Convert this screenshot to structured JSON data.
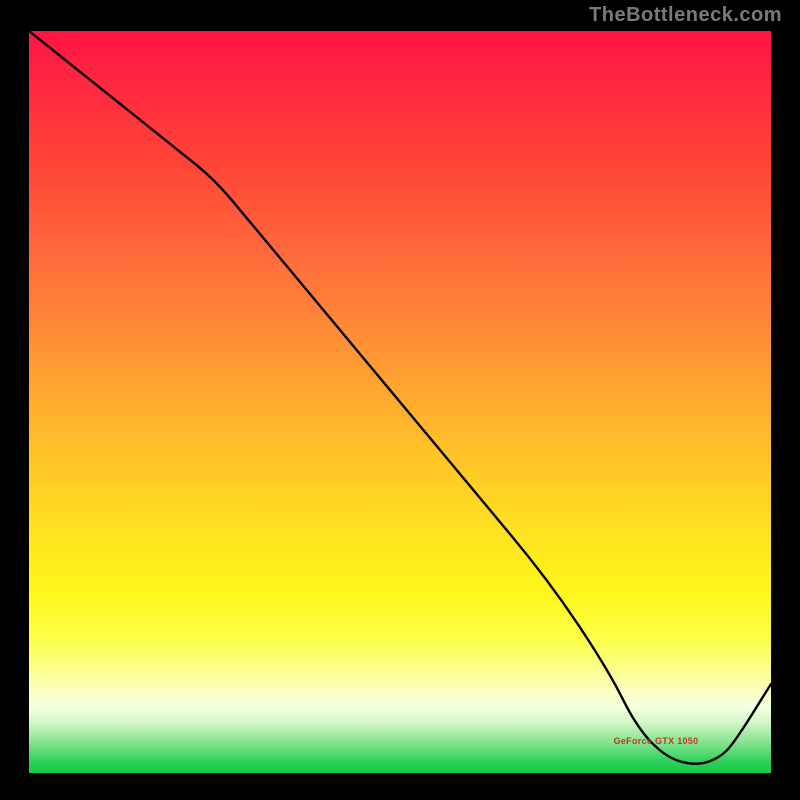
{
  "attribution": "TheBottleneck.com",
  "chart_data": {
    "type": "line",
    "title": "",
    "xlabel": "",
    "ylabel": "",
    "xlim": [
      0,
      100
    ],
    "ylim": [
      0,
      100
    ],
    "grid": false,
    "legend_position": "none",
    "series": [
      {
        "name": "GeForce GTX 1050",
        "x": [
          0,
          10,
          20,
          25,
          30,
          40,
          50,
          60,
          70,
          78,
          82,
          86,
          90,
          93,
          95,
          100
        ],
        "values": [
          100,
          92,
          84,
          80,
          74,
          62,
          50,
          38,
          26,
          14,
          6,
          2,
          1,
          2,
          4,
          12
        ]
      }
    ],
    "annotations": []
  }
}
